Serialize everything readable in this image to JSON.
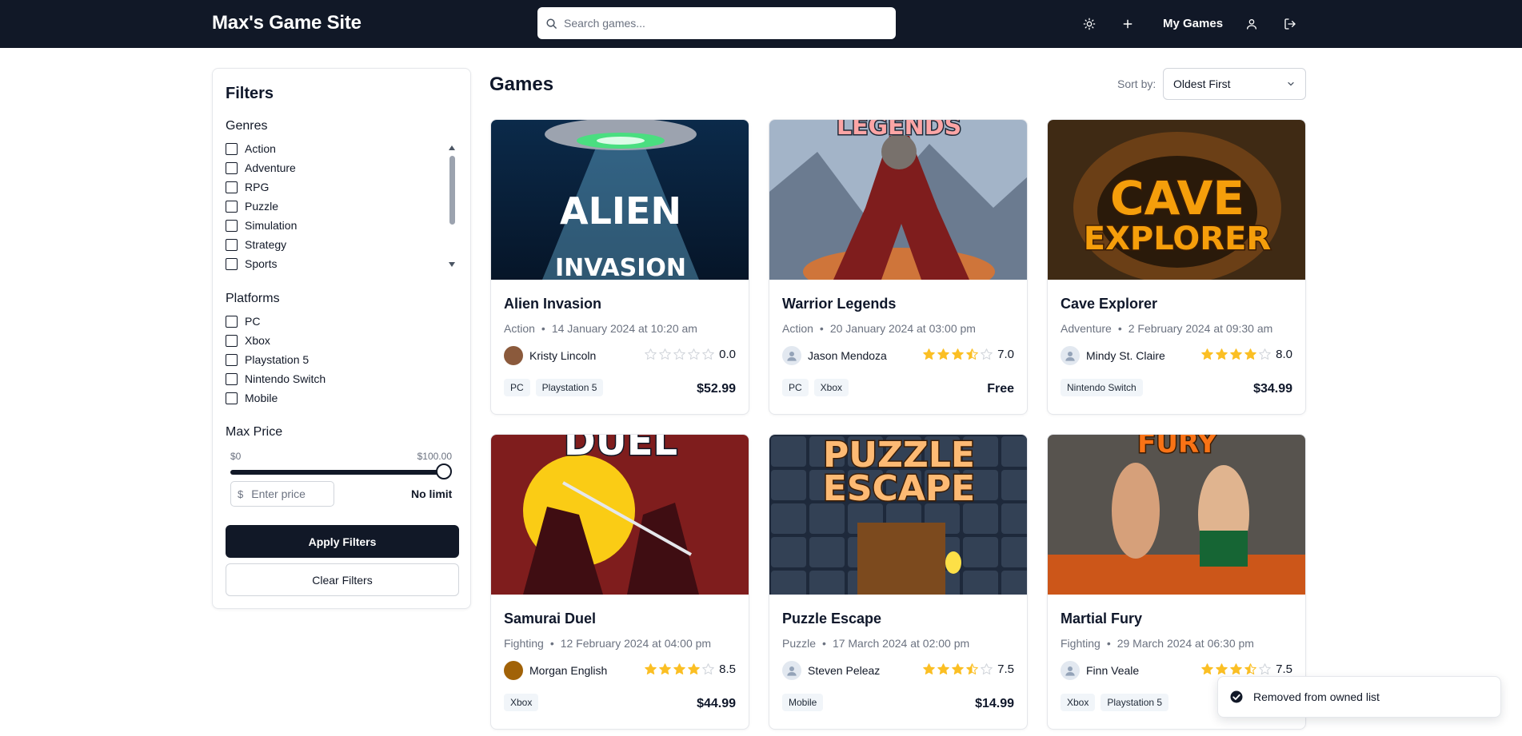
{
  "header": {
    "brand": "Max's Game Site",
    "search_placeholder": "Search games...",
    "my_games_label": "My Games",
    "icons": [
      "theme-toggle-icon",
      "plus-icon",
      "user-icon",
      "logout-icon"
    ]
  },
  "filters": {
    "title": "Filters",
    "genres_label": "Genres",
    "genres": [
      "Action",
      "Adventure",
      "RPG",
      "Puzzle",
      "Simulation",
      "Strategy",
      "Sports"
    ],
    "platforms_label": "Platforms",
    "platforms": [
      "PC",
      "Xbox",
      "Playstation 5",
      "Nintendo Switch",
      "Mobile"
    ],
    "max_price_label": "Max Price",
    "price_min_label": "$0",
    "price_max_label": "$100.00",
    "slider_value_fraction": 1.0,
    "price_currency": "$",
    "price_placeholder": "Enter price",
    "no_limit_label": "No limit",
    "apply_label": "Apply Filters",
    "clear_label": "Clear Filters"
  },
  "main": {
    "title": "Games",
    "sort_label": "Sort by:",
    "sort_value": "Oldest First"
  },
  "games": [
    {
      "title": "Alien Invasion",
      "genre": "Action",
      "date": "14 January 2024 at 10:20 am",
      "user": "Kristy Lincoln",
      "rating": 0,
      "rating_label": "0.0",
      "platforms": [
        "PC",
        "Playstation 5"
      ],
      "price": "$52.99",
      "cover_text": [
        "ALIEN",
        "INVASION"
      ]
    },
    {
      "title": "Warrior Legends",
      "genre": "Action",
      "date": "20 January 2024 at 03:00 pm",
      "user": "Jason Mendoza",
      "rating": 3.5,
      "rating_label": "7.0",
      "platforms": [
        "PC",
        "Xbox"
      ],
      "price": "Free",
      "cover_text": [
        "LEGENDS"
      ]
    },
    {
      "title": "Cave Explorer",
      "genre": "Adventure",
      "date": "2 February 2024 at 09:30 am",
      "user": "Mindy St. Claire",
      "rating": 4,
      "rating_label": "8.0",
      "platforms": [
        "Nintendo Switch"
      ],
      "price": "$34.99",
      "cover_text": [
        "CAVE",
        "EXPLORER"
      ]
    },
    {
      "title": "Samurai Duel",
      "genre": "Fighting",
      "date": "12 February 2024 at 04:00 pm",
      "user": "Morgan English",
      "rating": 4,
      "rating_label": "8.5",
      "platforms": [
        "Xbox"
      ],
      "price": "$44.99",
      "cover_text": [
        "DUEL"
      ]
    },
    {
      "title": "Puzzle Escape",
      "genre": "Puzzle",
      "date": "17 March 2024 at 02:00 pm",
      "user": "Steven Peleaz",
      "rating": 3.5,
      "rating_label": "7.5",
      "platforms": [
        "Mobile"
      ],
      "price": "$14.99",
      "cover_text": [
        "PUZZLE",
        "ESCAPE"
      ]
    },
    {
      "title": "Martial Fury",
      "genre": "Fighting",
      "date": "29 March 2024 at 06:30 pm",
      "user": "Finn Veale",
      "rating": 3.5,
      "rating_label": "7.5",
      "platforms": [
        "Xbox",
        "Playstation 5"
      ],
      "price": "",
      "cover_text": [
        "FURY"
      ]
    }
  ],
  "toast": {
    "message": "Removed from owned list"
  },
  "colors": {
    "header_bg": "#111827",
    "star_filled": "#fbbf24",
    "star_empty": "#d1d5db",
    "accent_dark": "#111827"
  }
}
